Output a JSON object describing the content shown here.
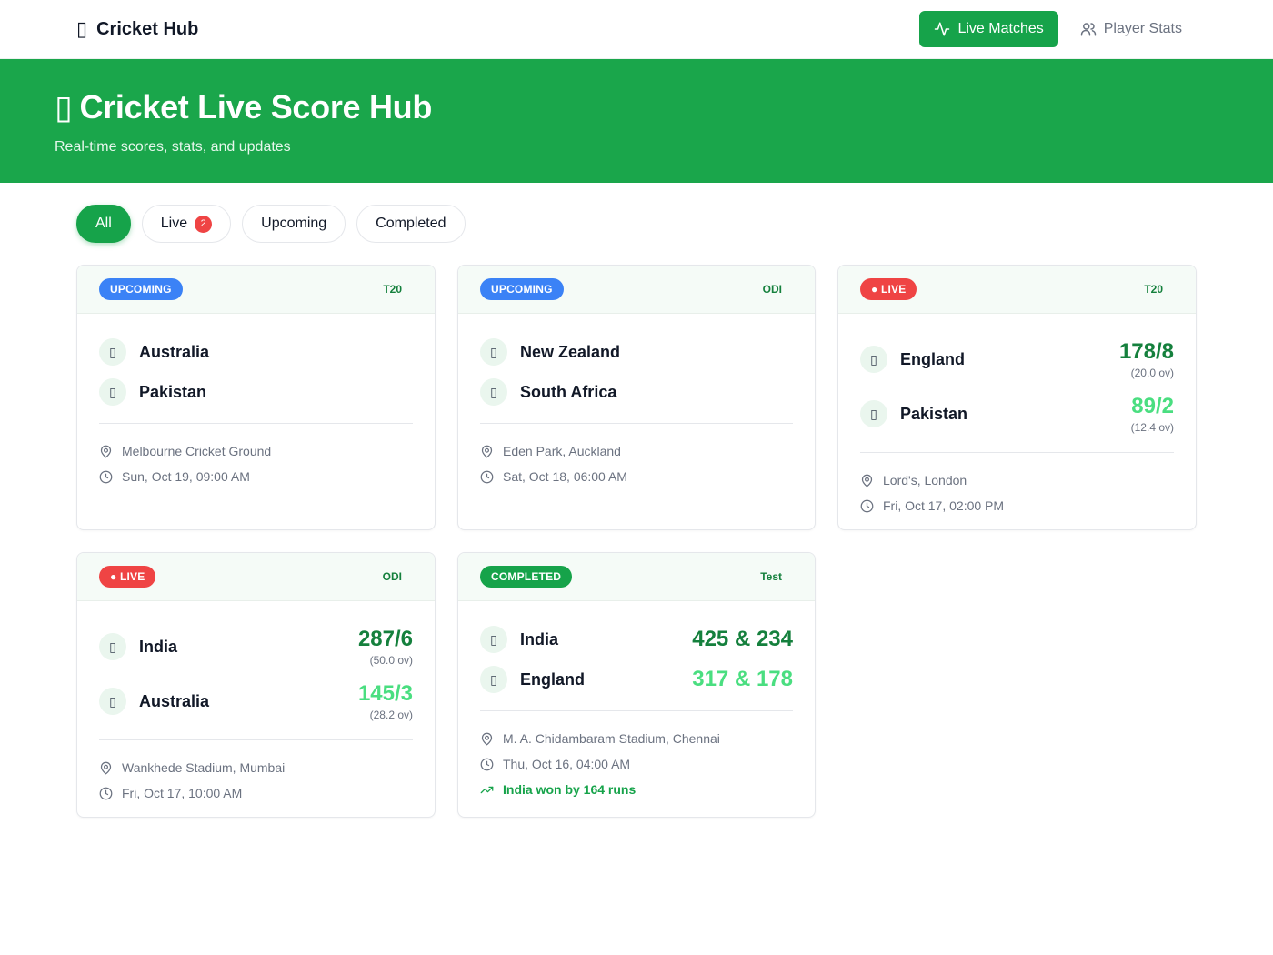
{
  "nav": {
    "brand_glyph": "▯",
    "brand": "Cricket Hub",
    "live_label": "Live Matches",
    "stats_label": "Player Stats"
  },
  "hero": {
    "glyph": "▯",
    "title": "Cricket Live Score Hub",
    "subtitle": "Real-time scores, stats, and updates"
  },
  "filters": {
    "all": "All",
    "live": "Live",
    "live_count": "2",
    "upcoming": "Upcoming",
    "completed": "Completed"
  },
  "matches": [
    {
      "status": "UPCOMING",
      "format": "T20",
      "team1": {
        "flag": "▯",
        "name": "Australia"
      },
      "team2": {
        "flag": "▯",
        "name": "Pakistan"
      },
      "venue": "Melbourne Cricket Ground",
      "time": "Sun, Oct 19, 09:00 AM"
    },
    {
      "status": "UPCOMING",
      "format": "ODI",
      "team1": {
        "flag": "▯",
        "name": "New Zealand"
      },
      "team2": {
        "flag": "▯",
        "name": "South Africa"
      },
      "venue": "Eden Park, Auckland",
      "time": "Sat, Oct 18, 06:00 AM"
    },
    {
      "status": "● LIVE",
      "format": "T20",
      "team1": {
        "flag": "▯",
        "name": "England",
        "score": "178/8",
        "overs": "(20.0 ov)"
      },
      "team2": {
        "flag": "▯",
        "name": "Pakistan",
        "score": "89/2",
        "overs": "(12.4 ov)"
      },
      "venue": "Lord's, London",
      "time": "Fri, Oct 17, 02:00 PM"
    },
    {
      "status": "● LIVE",
      "format": "ODI",
      "team1": {
        "flag": "▯",
        "name": "India",
        "score": "287/6",
        "overs": "(50.0 ov)"
      },
      "team2": {
        "flag": "▯",
        "name": "Australia",
        "score": "145/3",
        "overs": "(28.2 ov)"
      },
      "venue": "Wankhede Stadium, Mumbai",
      "time": "Fri, Oct 17, 10:00 AM"
    },
    {
      "status": "COMPLETED",
      "format": "Test",
      "team1": {
        "flag": "▯",
        "name": "India",
        "score": "425 & 234"
      },
      "team2": {
        "flag": "▯",
        "name": "England",
        "score": "317 & 178"
      },
      "venue": "M. A. Chidambaram Stadium, Chennai",
      "time": "Thu, Oct 16, 04:00 AM",
      "result": "India won by 164 runs"
    }
  ],
  "colors": {
    "primary": "#16a34a",
    "hero": "#1aa64b",
    "live": "#ef4444",
    "upcoming": "#3b82f6"
  }
}
